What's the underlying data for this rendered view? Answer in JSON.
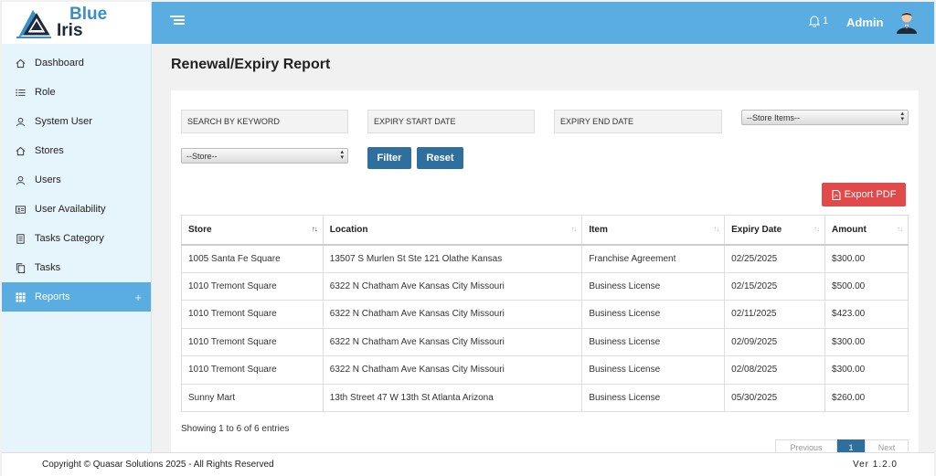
{
  "brand": {
    "line1": "Blue",
    "line2": "Iris"
  },
  "sidebar": {
    "items": [
      {
        "label": "Dashboard",
        "icon": "home-icon"
      },
      {
        "label": "Role",
        "icon": "list-icon"
      },
      {
        "label": "System User",
        "icon": "user-icon"
      },
      {
        "label": "Stores",
        "icon": "home-icon"
      },
      {
        "label": "Users",
        "icon": "user-icon"
      },
      {
        "label": "User Availability",
        "icon": "id-card-icon"
      },
      {
        "label": "Tasks Category",
        "icon": "document-icon"
      },
      {
        "label": "Tasks",
        "icon": "copy-icon"
      },
      {
        "label": "Reports",
        "icon": "grid-icon",
        "active": true,
        "expand": "+"
      }
    ]
  },
  "header": {
    "notification_count": "1",
    "user_name": "Admin"
  },
  "page": {
    "title": "Renewal/Expiry Report"
  },
  "filters": {
    "keyword_placeholder": "SEARCH BY KEYWORD",
    "start_date_placeholder": "EXPIRY START DATE",
    "end_date_placeholder": "EXPIRY END DATE",
    "store_items_selected": "--Store Items--",
    "store_selected": "--Store--",
    "filter_label": "Filter",
    "reset_label": "Reset"
  },
  "export_label": "Export PDF",
  "table": {
    "columns": [
      "Store",
      "Location",
      "Item",
      "Expiry Date",
      "Amount"
    ],
    "rows": [
      [
        "1005 Santa Fe Square",
        "13507 S Murlen St Ste 121 Olathe Kansas",
        "Franchise Agreement",
        "02/25/2025",
        "$300.00"
      ],
      [
        "1010 Tremont Square",
        "6322 N Chatham Ave Kansas City Missouri",
        "Business License",
        "02/15/2025",
        "$500.00"
      ],
      [
        "1010 Tremont Square",
        "6322 N Chatham Ave Kansas City Missouri",
        "Business License",
        "02/11/2025",
        "$423.00"
      ],
      [
        "1010 Tremont Square",
        "6322 N Chatham Ave Kansas City Missouri",
        "Business License",
        "02/09/2025",
        "$300.00"
      ],
      [
        "1010 Tremont Square",
        "6322 N Chatham Ave Kansas City Missouri",
        "Business License",
        "02/08/2025",
        "$300.00"
      ],
      [
        "Sunny Mart",
        "13th Street 47 W 13th St Atlanta Arizona",
        "Business License",
        "05/30/2025",
        "$260.00"
      ]
    ]
  },
  "table_info": "Showing 1 to 6 of 6 entries",
  "pagination": {
    "prev": "Previous",
    "current": "1",
    "next": "Next"
  },
  "footer": {
    "copyright": "Copyright © Quasar Solutions 2025 - All Rights Reserved",
    "version": "Ver 1.2.0"
  },
  "colors": {
    "header": "#5aade0",
    "sidebar": "#e6f5fc",
    "primary_button": "#2e6f9e",
    "export_button": "#e04a4a"
  }
}
